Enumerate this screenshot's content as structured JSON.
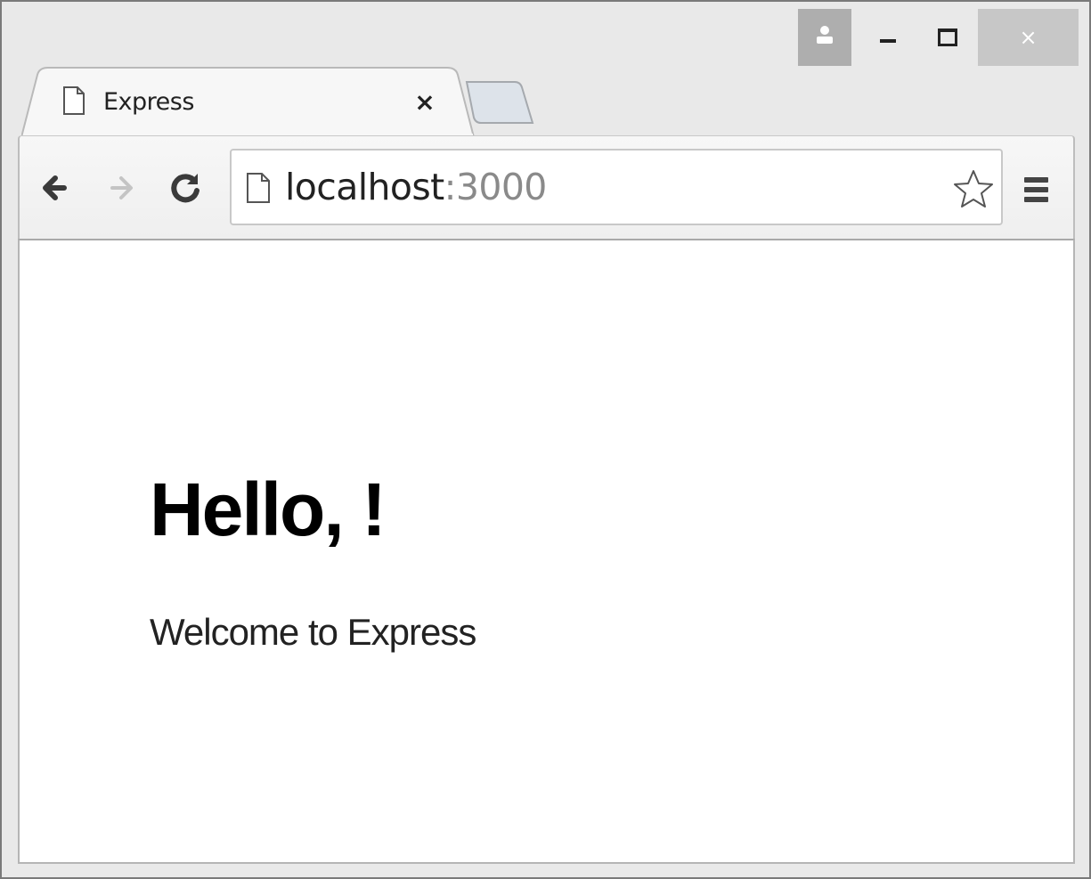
{
  "window": {
    "close_glyph": "×",
    "colors": {
      "frame": "#e9e9e9",
      "profile_button": "#aeaeae",
      "close_button": "#c7c7c7"
    }
  },
  "tabs": [
    {
      "title": "Express",
      "icon": "page-icon",
      "close_glyph": "×",
      "active": true
    }
  ],
  "toolbar": {
    "back_icon": "arrow-left-icon",
    "forward_icon": "arrow-right-icon",
    "reload_icon": "reload-icon",
    "menu_icon": "hamburger-menu-icon",
    "address": {
      "host": "localhost",
      "port": ":3000",
      "icon": "page-icon",
      "bookmark_icon": "star-icon"
    }
  },
  "page": {
    "heading": "Hello, !",
    "text": "Welcome to Express"
  }
}
